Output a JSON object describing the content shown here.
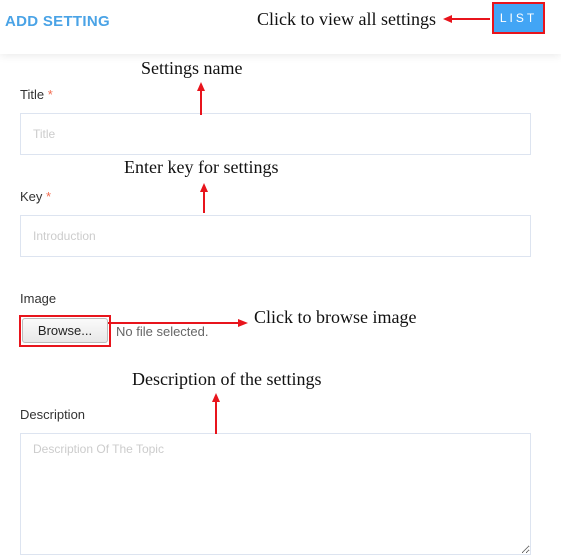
{
  "header": {
    "title": "ADD SETTING",
    "list_label": "LIST"
  },
  "form": {
    "title_label": "Title",
    "title_placeholder": "Title",
    "required_mark": "*",
    "key_label": "Key",
    "key_placeholder": "Introduction",
    "image_label": "Image",
    "browse_label": "Browse...",
    "no_file": "No file selected.",
    "description_label": "Description",
    "description_placeholder": "Description Of The Topic"
  },
  "annotations": {
    "list": "Click to view all settings",
    "title": "Settings name",
    "key": "Enter key for settings",
    "image": "Click to browse image",
    "description": "Description of the settings"
  },
  "colors": {
    "accent": "#42a5f5",
    "annotation": "#e8141c"
  }
}
